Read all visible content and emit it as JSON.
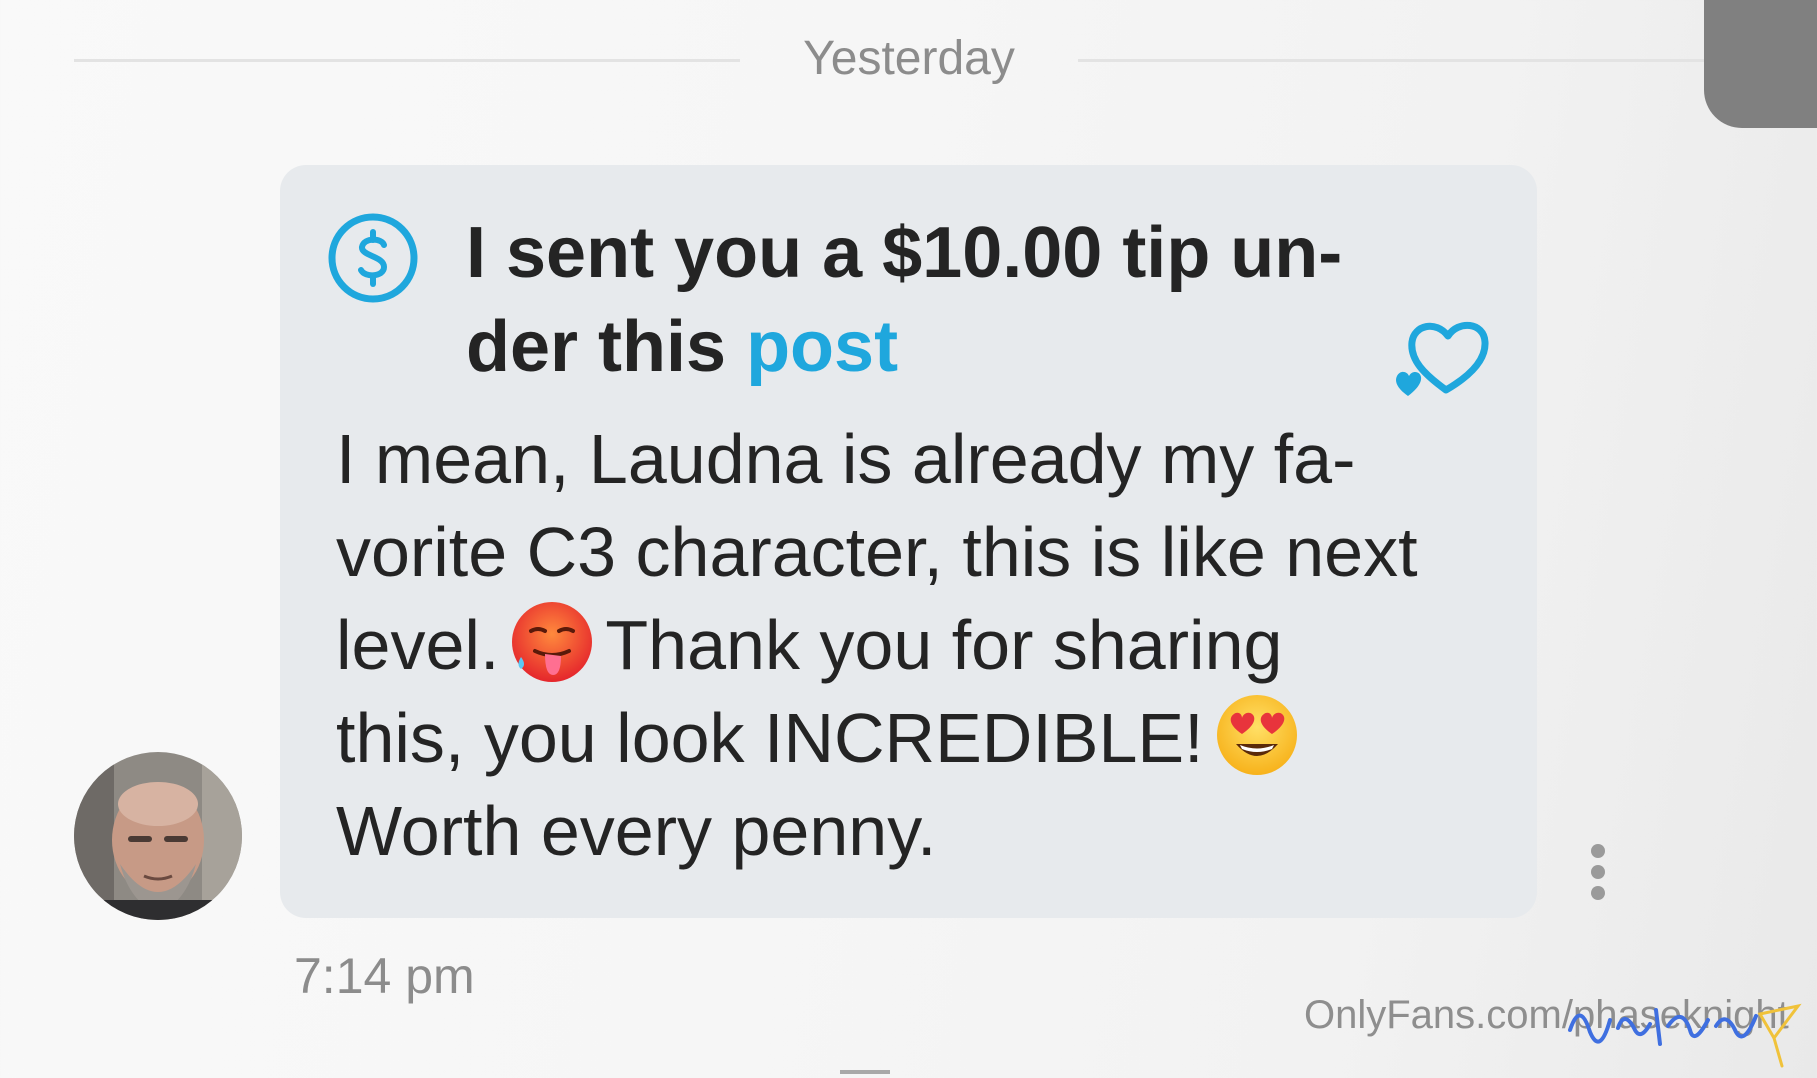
{
  "date_divider": {
    "label": "Yesterday"
  },
  "message": {
    "tip_line1": "I sent you a $10.00 tip un-",
    "tip_line2_prefix": "der this ",
    "tip_link": "post",
    "text_line1": "I mean, Laudna is already my fa-",
    "text_line2": "vorite C3 character, this is like next",
    "text_line3_a": "level.",
    "text_line3_b": "Thank you for sharing",
    "text_line4": "this, you look INCREDIBLE!",
    "text_line5": "Worth every penny.",
    "emoji_1": "hot-face",
    "emoji_2": "heart-eyes-face",
    "timestamp": "7:14 pm"
  },
  "icons": {
    "tip": "dollar-circle-icon",
    "like": "heart-icon",
    "more": "more-vertical-icon"
  },
  "colors": {
    "link": "#1fa7dd",
    "bubble": "#e7eaed",
    "muted_text": "#8c8c8c",
    "text": "#242424"
  },
  "watermark": {
    "text": "OnlyFans.com/phaseknight",
    "signature": "Hotsauce"
  }
}
